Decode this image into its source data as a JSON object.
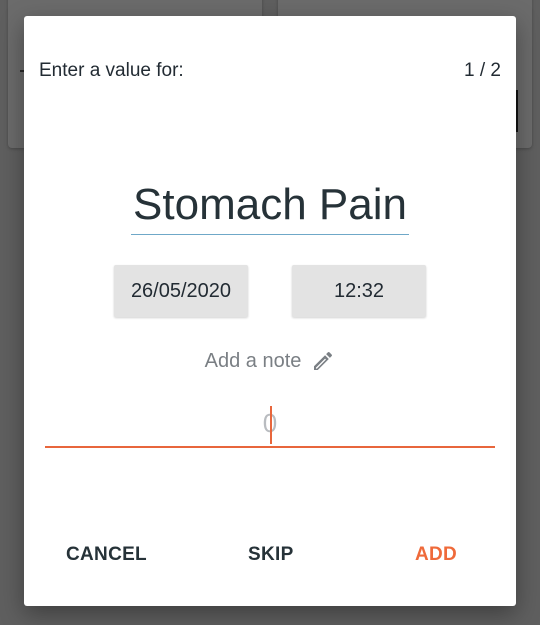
{
  "colors": {
    "accent": "#ef6a3a",
    "title_underline": "#6fa8c8",
    "picker_bg": "#e3e3e3",
    "text_primary": "#263238",
    "text_muted": "#7a7f84"
  },
  "dialog": {
    "prompt": "Enter a value for:",
    "step": "1 / 2",
    "symptom_name": "Stomach Pain",
    "date": "26/05/2020",
    "time": "12:32",
    "note_label": "Add a note",
    "note_icon": "pencil-icon",
    "value_placeholder": "0",
    "buttons": {
      "cancel": "CANCEL",
      "skip": "SKIP",
      "add": "ADD"
    }
  }
}
